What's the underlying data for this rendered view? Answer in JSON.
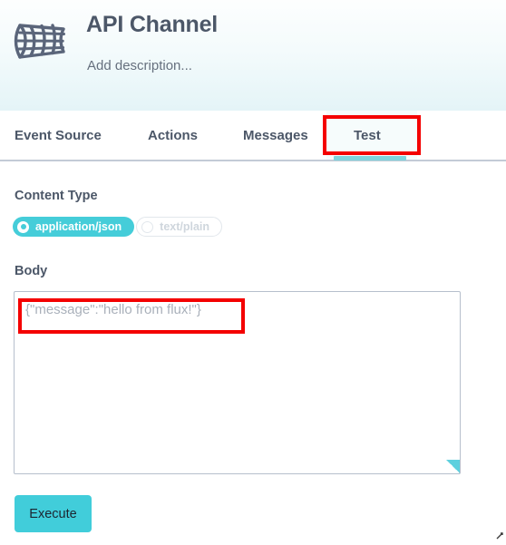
{
  "header": {
    "icon": "channel-mesh-icon",
    "title": "API Channel",
    "description": "Add description...",
    "gradient_top": "#fdfefe",
    "gradient_bottom": "#e4f4f7"
  },
  "tabs": {
    "items": [
      {
        "label": "Event Source",
        "active": false
      },
      {
        "label": "Actions",
        "active": false
      },
      {
        "label": "Messages",
        "active": false
      },
      {
        "label": "Test",
        "active": true
      }
    ],
    "active_underline_color": "#7fd4dd"
  },
  "annotations": {
    "color": "#f40000",
    "boxes": [
      {
        "target": "tab-test"
      },
      {
        "target": "body-text"
      }
    ]
  },
  "form": {
    "content_type": {
      "label": "Content Type",
      "options": [
        {
          "label": "application/json",
          "selected": true
        },
        {
          "label": "text/plain",
          "selected": false
        }
      ],
      "selected_color": "#45cdd9"
    },
    "body": {
      "label": "Body",
      "value": "{\"message\":\"hello from flux!\"}",
      "placeholder": "{\"message\":\"hello from flux!\"}",
      "resize_handle_color": "#5ed0de"
    }
  },
  "actions": {
    "execute_label": "Execute",
    "execute_color": "#41cdda"
  }
}
